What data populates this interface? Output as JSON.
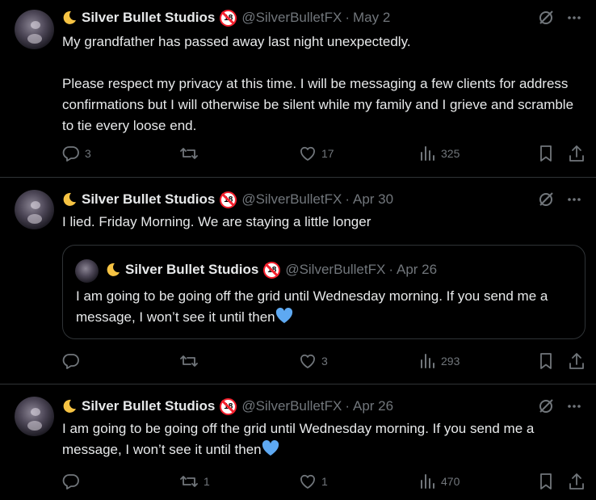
{
  "tweets": [
    {
      "author": {
        "name": "Silver Bullet Studios",
        "handle": "@SilverBulletFX"
      },
      "date": "May 2",
      "text": "My grandfather has passed away last night unexpectedly.\n\nPlease respect my privacy at this time. I will be messaging a few clients for address confirmations but I will otherwise be silent while my family and I grieve and scramble to tie every loose end.",
      "stats": {
        "replies": "3",
        "retweets": "",
        "likes": "17",
        "views": "325"
      }
    },
    {
      "author": {
        "name": "Silver Bullet Studios",
        "handle": "@SilverBulletFX"
      },
      "date": "Apr 30",
      "text": "I lied. Friday Morning. We are staying a little longer",
      "quote": {
        "author": {
          "name": "Silver Bullet Studios",
          "handle": "@SilverBulletFX"
        },
        "date": "Apr 26",
        "text": "I am going to be going off the grid until Wednesday morning. If you send me a message, I won’t see it until then"
      },
      "stats": {
        "replies": "",
        "retweets": "",
        "likes": "3",
        "views": "293"
      }
    },
    {
      "author": {
        "name": "Silver Bullet Studios",
        "handle": "@SilverBulletFX"
      },
      "date": "Apr 26",
      "text": "I am going to be going off the grid until Wednesday morning. If you send me a message, I won’t see it until then",
      "stats": {
        "replies": "",
        "retweets": "1",
        "likes": "1",
        "views": "470"
      }
    }
  ],
  "separator": "·",
  "colors": {
    "background": "#000000",
    "text": "#e7e9ea",
    "muted": "#71767b",
    "border": "#2f3336",
    "badge": "#f4212e",
    "heart": "#5ea9f2"
  },
  "icons": [
    "crescent-moon-emoji",
    "no-under-18-emoji",
    "grok-icon",
    "more-icon",
    "reply-icon",
    "retweet-icon",
    "like-icon",
    "views-icon",
    "bookmark-icon",
    "share-icon",
    "blue-heart-emoji"
  ]
}
